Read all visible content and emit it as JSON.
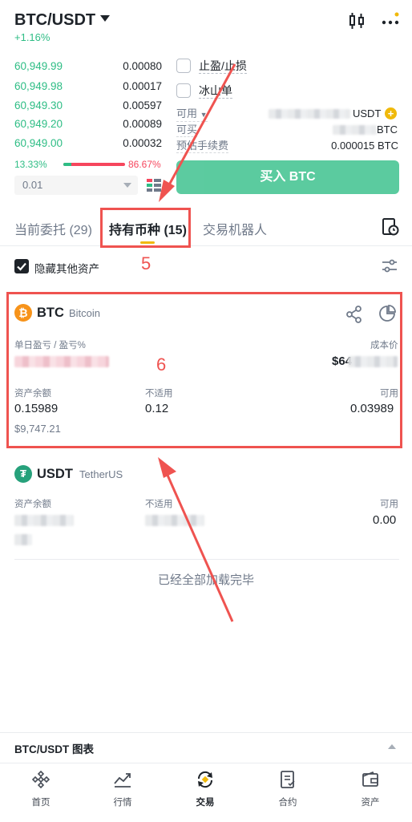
{
  "header": {
    "pair": "BTC/USDT",
    "change": "+1.16%"
  },
  "orderbook": {
    "rows": [
      {
        "price": "60,949.99",
        "qty": "0.00080"
      },
      {
        "price": "60,949.98",
        "qty": "0.00017"
      },
      {
        "price": "60,949.30",
        "qty": "0.00597"
      },
      {
        "price": "60,949.20",
        "qty": "0.00089"
      },
      {
        "price": "60,949.00",
        "qty": "0.00032"
      }
    ],
    "buy_ratio": "13.33%",
    "sell_ratio": "86.67%",
    "buy_ratio_value": 0.1333,
    "step": "0.01"
  },
  "order_form": {
    "tp_sl_label": "止盈/止损",
    "iceberg_label": "冰山单",
    "available_label": "可用",
    "available_unit": "USDT",
    "buyable_label": "可买",
    "buyable_unit": "BTC",
    "fee_label": "预估手续费",
    "fee_value": "0.000015 BTC",
    "buy_button": "买入 BTC"
  },
  "tabs": {
    "open_orders": "当前委托 (29)",
    "holdings": "持有币种 (15)",
    "bots": "交易机器人"
  },
  "hide_other": "隐藏其他资产",
  "annotations": {
    "box5": "5",
    "box6": "6"
  },
  "holdings": [
    {
      "symbol": "BTC",
      "name": "Bitcoin",
      "pnl_label": "单日盈亏 / 盈亏%",
      "cost_label": "成本价",
      "cost_value": "$64",
      "balance_label": "资产余额",
      "balance": "0.15989",
      "balance_usd": "$9,747.21",
      "na_label": "不适用",
      "na_value": "0.12",
      "avail_label": "可用",
      "avail_value": "0.03989"
    },
    {
      "symbol": "USDT",
      "name": "TetherUS",
      "balance_label": "资产余额",
      "na_label": "不适用",
      "avail_label": "可用",
      "avail_value": "0.00"
    }
  ],
  "loaded_text": "已经全部加载完毕",
  "chart_bar": {
    "title": "BTC/USDT 图表"
  },
  "nav": {
    "home": "首页",
    "markets": "行情",
    "trade": "交易",
    "futures": "合约",
    "assets": "资产"
  },
  "colors": {
    "green": "#2ebd85",
    "red": "#f6465d",
    "yellow": "#f0b90b",
    "annotation": "#ef5350"
  }
}
